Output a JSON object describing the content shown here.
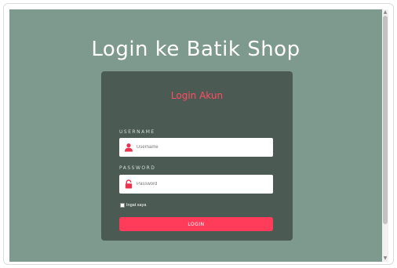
{
  "page": {
    "title": "Login ke Batik Shop"
  },
  "card": {
    "title": "Login Akun",
    "username": {
      "label": "USERNAME",
      "placeholder": "Username",
      "icon": "user-icon"
    },
    "password": {
      "label": "PASSWORD",
      "placeholder": "Password",
      "icon": "lock-icon"
    },
    "remember": {
      "label": "Ingat saya",
      "checked": false
    },
    "submit_label": "LOGIN"
  },
  "colors": {
    "background": "#7e9a8f",
    "card": "#4b5a52",
    "accent": "#ff3d5a",
    "title_accent": "#ff4d64"
  }
}
